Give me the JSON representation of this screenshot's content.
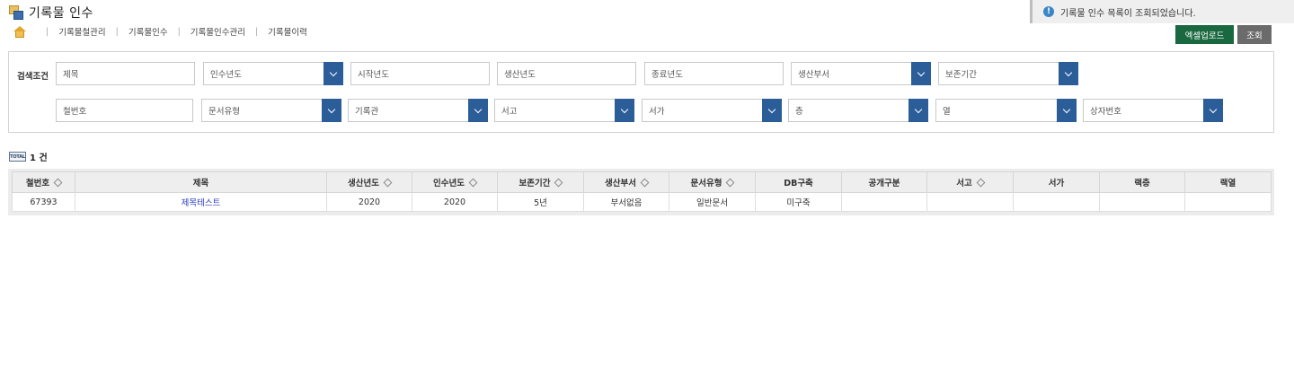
{
  "page": {
    "title": "기록물 인수"
  },
  "subnav": {
    "items": [
      "기록물철관리",
      "기록물인수",
      "기록물인수관리",
      "기록물이력"
    ],
    "separator": "|"
  },
  "toast": {
    "icon": "info-icon",
    "message": "기록물 인수 목록이 조회되었습니다."
  },
  "toolbar": {
    "excel_label": "엑셀업로드",
    "search_label": "조회"
  },
  "search": {
    "label": "검색조건",
    "row1": {
      "title_ph": "제목",
      "accept_year": "인수년도",
      "start_year_ph": "시작년도",
      "produce_year_ph": "생산년도",
      "end_year_ph": "종료년도",
      "produce_dept": "생산부서",
      "retention": "보존기간"
    },
    "row2": {
      "file_no_ph": "철번호",
      "doc_type": "문서유형",
      "archive": "기록관",
      "storage": "서고",
      "shelf": "서가",
      "floor": "층",
      "column": "열",
      "box_no": "상자번호"
    }
  },
  "result": {
    "total_icon_text": "TOTAL",
    "count_label": "1 건"
  },
  "table": {
    "columns": [
      "철번호",
      "제목",
      "생산년도",
      "인수년도",
      "보존기간",
      "생산부서",
      "문서유형",
      "DB구축",
      "공개구분",
      "서고",
      "서가",
      "랙층",
      "랙열"
    ],
    "rows": [
      [
        "67393",
        "제목테스트",
        "2020",
        "2020",
        "5년",
        "부서없음",
        "일반문서",
        "미구축",
        "",
        "",
        "",
        "",
        ""
      ]
    ]
  },
  "colors": {
    "excel_button": "#19683f",
    "search_button": "#6b6b6b",
    "select_caret": "#2b5d98",
    "title_link": "#2a3ec0"
  }
}
